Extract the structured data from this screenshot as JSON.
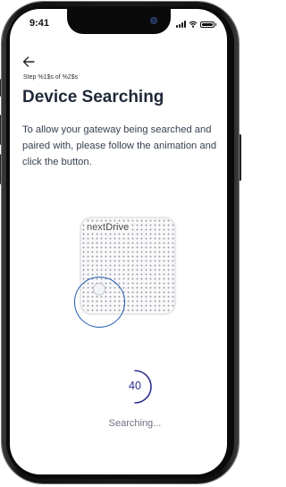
{
  "status_bar": {
    "time": "9:41"
  },
  "header": {
    "back_icon": "arrow-left-icon",
    "step_text": "Step %1$s of %2$s",
    "title": "Device Searching",
    "description": "To allow your gateway being searched and paired with, please follow the animation and click the button."
  },
  "device": {
    "brand_prefix": "next",
    "brand_suffix": "Drive"
  },
  "countdown": {
    "value": "40",
    "status_text": "Searching..."
  },
  "colors": {
    "accent": "#2b2f8f",
    "highlight_ring": "#1f5bb0",
    "title": "#1f2937",
    "body_text": "#374151",
    "muted_text": "#6b7280"
  }
}
